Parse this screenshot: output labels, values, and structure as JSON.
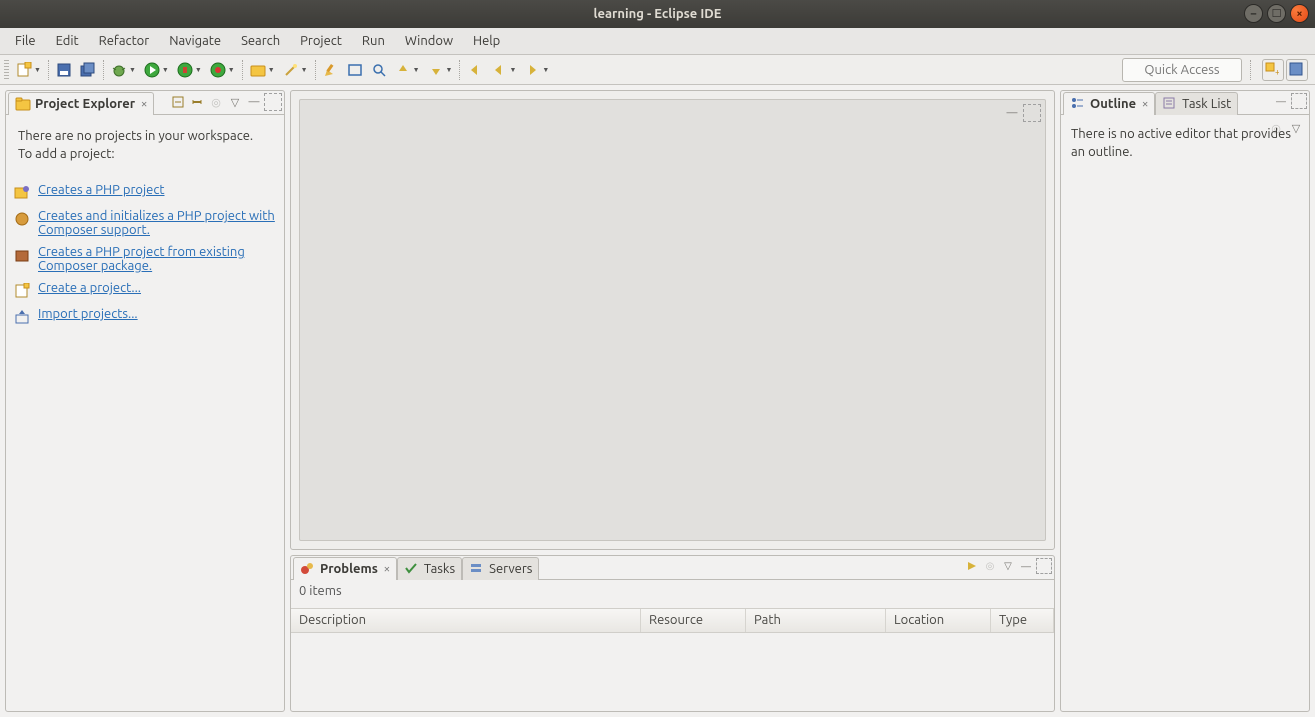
{
  "window": {
    "title": "learning - Eclipse IDE"
  },
  "menu": {
    "items": [
      "File",
      "Edit",
      "Refactor",
      "Navigate",
      "Search",
      "Project",
      "Run",
      "Window",
      "Help"
    ]
  },
  "toolbar": {
    "quick_access": "Quick Access"
  },
  "explorer": {
    "tab_label": "Project Explorer",
    "empty_msg1": "There are no projects in your workspace.",
    "empty_msg2": "To add a project:",
    "wizards": [
      {
        "icon": "php-wizard",
        "label": "Creates a PHP project"
      },
      {
        "icon": "composer-wizard",
        "label": "Creates and initializes a PHP project with Composer support."
      },
      {
        "icon": "composer-pkg",
        "label": "Creates a PHP project from existing Composer package."
      },
      {
        "icon": "new-project",
        "label": "Create a project..."
      },
      {
        "icon": "import",
        "label": "Import projects..."
      }
    ]
  },
  "outline": {
    "tab_label": "Outline",
    "tasklist_label": "Task List",
    "empty_msg": "There is no active editor that provides an outline."
  },
  "bottom": {
    "tabs": {
      "problems": "Problems",
      "tasks": "Tasks",
      "servers": "Servers"
    },
    "items_label": "0 items",
    "columns": {
      "description": "Description",
      "resource": "Resource",
      "path": "Path",
      "location": "Location",
      "type": "Type"
    }
  }
}
